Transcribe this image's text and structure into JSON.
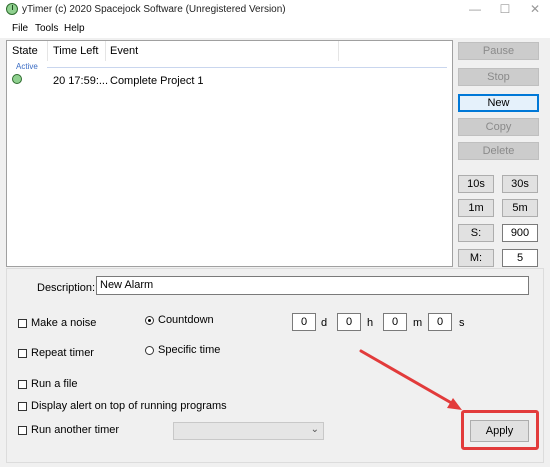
{
  "window": {
    "title": "yTimer (c) 2020 Spacejock Software (Unregistered Version)",
    "app_icon": "clock-icon",
    "controls": {
      "minimize": "—",
      "maximize": "☐",
      "close": "✕"
    }
  },
  "menu": {
    "items": [
      "File",
      "Tools",
      "Help"
    ]
  },
  "list": {
    "columns": [
      "State",
      "Time Left",
      "Event"
    ],
    "group": "Active",
    "rows": [
      {
        "state_icon": "active-timer-icon",
        "time_left": "20 17:59:...",
        "event": "Complete Project 1"
      }
    ]
  },
  "side_buttons": {
    "pause": "Pause",
    "stop": "Stop",
    "new": "New",
    "copy": "Copy",
    "delete": "Delete",
    "s10": "10s",
    "s30": "30s",
    "m1": "1m",
    "m5": "5m",
    "s_label": "S:",
    "s_value": "900",
    "m_label": "M:",
    "m_value": "5"
  },
  "form": {
    "description_label": "Description:",
    "description_value": "New Alarm",
    "make_noise": "Make a noise",
    "repeat_timer": "Repeat timer",
    "run_file": "Run a file",
    "display_alert": "Display alert on top of running programs",
    "run_another": "Run another timer",
    "countdown": "Countdown",
    "specific_time": "Specific time",
    "duration": {
      "d_value": "0",
      "d_unit": "d",
      "h_value": "0",
      "h_unit": "h",
      "m_value": "0",
      "m_unit": "m",
      "s_value": "0",
      "s_unit": "s"
    },
    "combo_value": "",
    "apply": "Apply"
  },
  "annotation": {
    "color": "#e23b3b"
  }
}
